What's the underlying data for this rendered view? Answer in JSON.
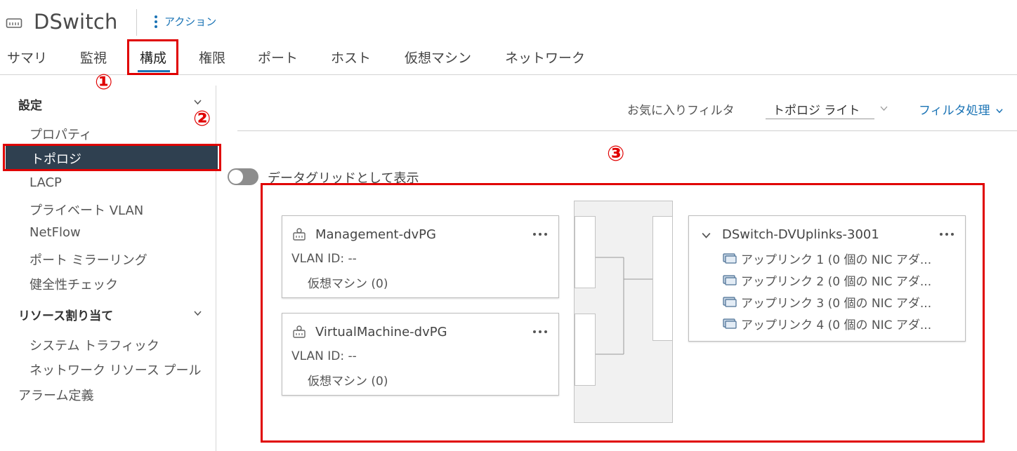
{
  "header": {
    "title": "DSwitch",
    "actions_label": "アクション",
    "icon": "switch-icon"
  },
  "tabs": [
    {
      "label": "サマリ"
    },
    {
      "label": "監視"
    },
    {
      "label": "構成",
      "active": true
    },
    {
      "label": "権限"
    },
    {
      "label": "ポート"
    },
    {
      "label": "ホスト"
    },
    {
      "label": "仮想マシン"
    },
    {
      "label": "ネットワーク"
    }
  ],
  "sidebar": {
    "settings_header": "設定",
    "settings_items": [
      "プロパティ",
      "トポロジ",
      "LACP",
      "プライベート VLAN",
      "NetFlow",
      "ポート ミラーリング",
      "健全性チェック"
    ],
    "selected_item": "トポロジ",
    "resource_header": "リソース割り当て",
    "resource_items": [
      "システム トラフィック",
      "ネットワーク リソース プール"
    ],
    "alarm": "アラーム定義"
  },
  "filter": {
    "favorites_label": "お気に入りフィルタ",
    "selected": "トポロジ ライト",
    "action_label": "フィルタ処理"
  },
  "toggle": {
    "label": "データグリッドとして表示",
    "on": false
  },
  "topology": {
    "portgroups": [
      {
        "name": "Management-dvPG",
        "vlan": "VLAN ID: --",
        "vms": "仮想マシン (0)"
      },
      {
        "name": "VirtualMachine-dvPG",
        "vlan": "VLAN ID: --",
        "vms": "仮想マシン (0)"
      }
    ],
    "uplinks": {
      "name": "DSwitch-DVUplinks-3001",
      "items": [
        "アップリンク 1 (0 個の NIC アダ...",
        "アップリンク 2 (0 個の NIC アダ...",
        "アップリンク 3 (0 個の NIC アダ...",
        "アップリンク 4 (0 個の NIC アダ..."
      ]
    }
  },
  "annotations": {
    "n1": "①",
    "n2": "②",
    "n3": "③",
    "color": "#e00000"
  },
  "colors": {
    "accent": "#1a73b5",
    "selected_bg": "#2f4050"
  }
}
